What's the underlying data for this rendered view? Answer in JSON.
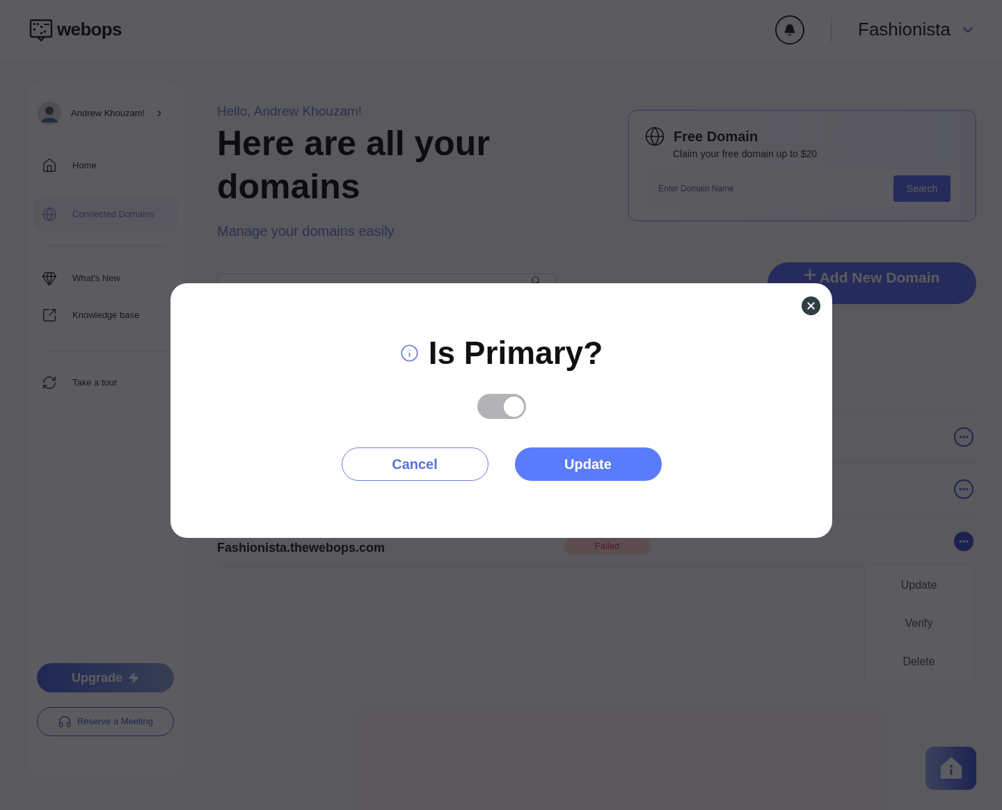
{
  "header": {
    "logo": "webops",
    "workspace": "Fashionista"
  },
  "sidebar": {
    "user": "Andrew Khouzam!",
    "nav": [
      {
        "label": "Home",
        "selected": false
      },
      {
        "label": "Connected Domains",
        "selected": true
      }
    ],
    "resources": [
      {
        "label": "What's New"
      },
      {
        "label": "Knowledge base"
      }
    ],
    "tour": "Take a tour",
    "upgrade": "Upgrade",
    "meeting": "Reserve a Meeting"
  },
  "greeting": "Hello, Andrew Khouzam!",
  "heading": "Here are all your domains",
  "subheading": "Manage your domains easily",
  "free_domain": {
    "title": "Free Domain",
    "subtitle": "Claim your free domain up to $20",
    "placeholder": "Enter Domain Name",
    "button": "Search"
  },
  "add_button": "Add New Domain",
  "rows": [
    {
      "menu_open": false
    },
    {
      "menu_open": false
    },
    {
      "domain": "Fashionista.thewebops.com",
      "status": "Failed",
      "menu_open": true
    }
  ],
  "row_menu": [
    "Update",
    "Verify",
    "Delete"
  ],
  "dialog": {
    "title": "Is Primary?",
    "toggle": {
      "on": true,
      "disabled": true
    },
    "buttons": [
      {
        "label": "Cancel",
        "kind": "secondary"
      },
      {
        "label": "Update",
        "kind": "primary"
      }
    ]
  }
}
